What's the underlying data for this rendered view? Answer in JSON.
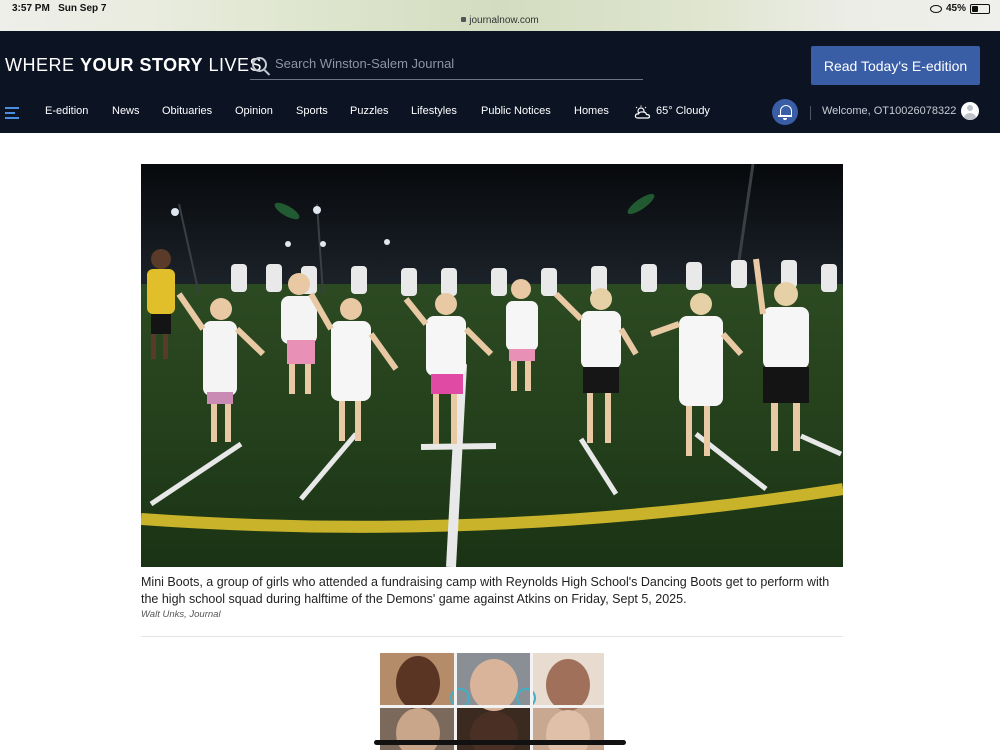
{
  "status_bar": {
    "time": "3:57 PM",
    "date": "Sun Sep 7",
    "url": "journalnow.com",
    "battery_text": "45%",
    "battery_level": 0.45
  },
  "header": {
    "tagline_part1": "WHERE ",
    "tagline_part2": "YOUR STORY",
    "tagline_part3": " LIVES",
    "search_placeholder": "Search Winston-Salem Journal",
    "eedition_button": "Read Today's E-edition"
  },
  "nav": {
    "items": [
      "E-edition",
      "News",
      "Obituaries",
      "Opinion",
      "Sports",
      "Puzzles",
      "Lifestyles",
      "Public Notices",
      "Homes"
    ],
    "weather": "65° Cloudy",
    "welcome": "Welcome, OT10026078322"
  },
  "article": {
    "caption": "Mini Boots, a group of girls who attended a fundraising camp with Reynolds High School's Dancing Boots get to perform with the high school squad during halftime of the Demons' game against Atkins on Friday, Sept 5, 2025.",
    "credit": "Walt Unks, Journal"
  },
  "colors": {
    "header_bg": "#0c1424",
    "button_blue": "#3a5ea6",
    "accent_icon": "#4a8fe0"
  },
  "icons": {
    "menu": "hamburger-icon",
    "search": "search-icon",
    "weather": "partly-cloudy-icon",
    "notifications": "bell-icon",
    "account": "avatar-icon"
  }
}
